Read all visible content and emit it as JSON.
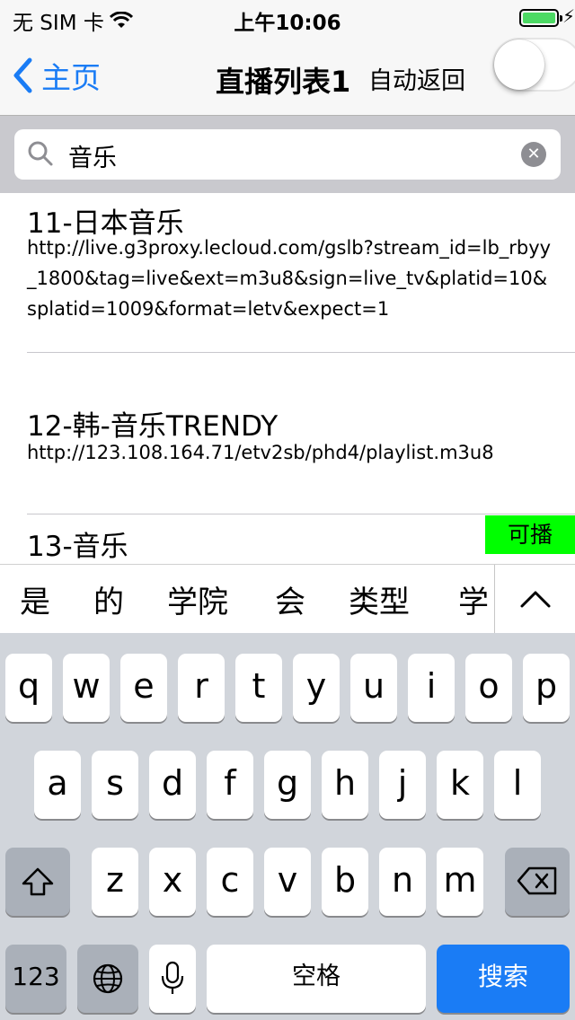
{
  "status": {
    "carrier": "无 SIM 卡",
    "time": "上午10:06"
  },
  "nav": {
    "back_label": "主页",
    "title": "直播列表1",
    "auto_return_label": "自动返回",
    "auto_return_on": false
  },
  "search": {
    "value": "音乐"
  },
  "channels": [
    {
      "name": "11-日本音乐",
      "url": "http://live.g3proxy.lecloud.com/gslb?stream_id=lb_rbyy_1800&tag=live&ext=m3u8&sign=live_tv&platid=10&splatid=1009&format=letv&expect=1"
    },
    {
      "name": "12-韩-音乐TRENDY",
      "url": "http://123.108.164.71/etv2sb/phd4/playlist.m3u8"
    },
    {
      "name": "13-音乐",
      "badge": "可播"
    }
  ],
  "candidates": [
    "是",
    "的",
    "学院",
    "会",
    "类型",
    "学"
  ],
  "keyboard": {
    "row1": [
      "q",
      "w",
      "e",
      "r",
      "t",
      "y",
      "u",
      "i",
      "o",
      "p"
    ],
    "row2": [
      "a",
      "s",
      "d",
      "f",
      "g",
      "h",
      "j",
      "k",
      "l"
    ],
    "row3": [
      "z",
      "x",
      "c",
      "v",
      "b",
      "n",
      "m"
    ],
    "numbers_label": "123",
    "space_label": "空格",
    "search_label": "搜索"
  },
  "colors": {
    "accent": "#1a7cf5",
    "badge": "#00ff00",
    "battery": "#4cd964"
  }
}
